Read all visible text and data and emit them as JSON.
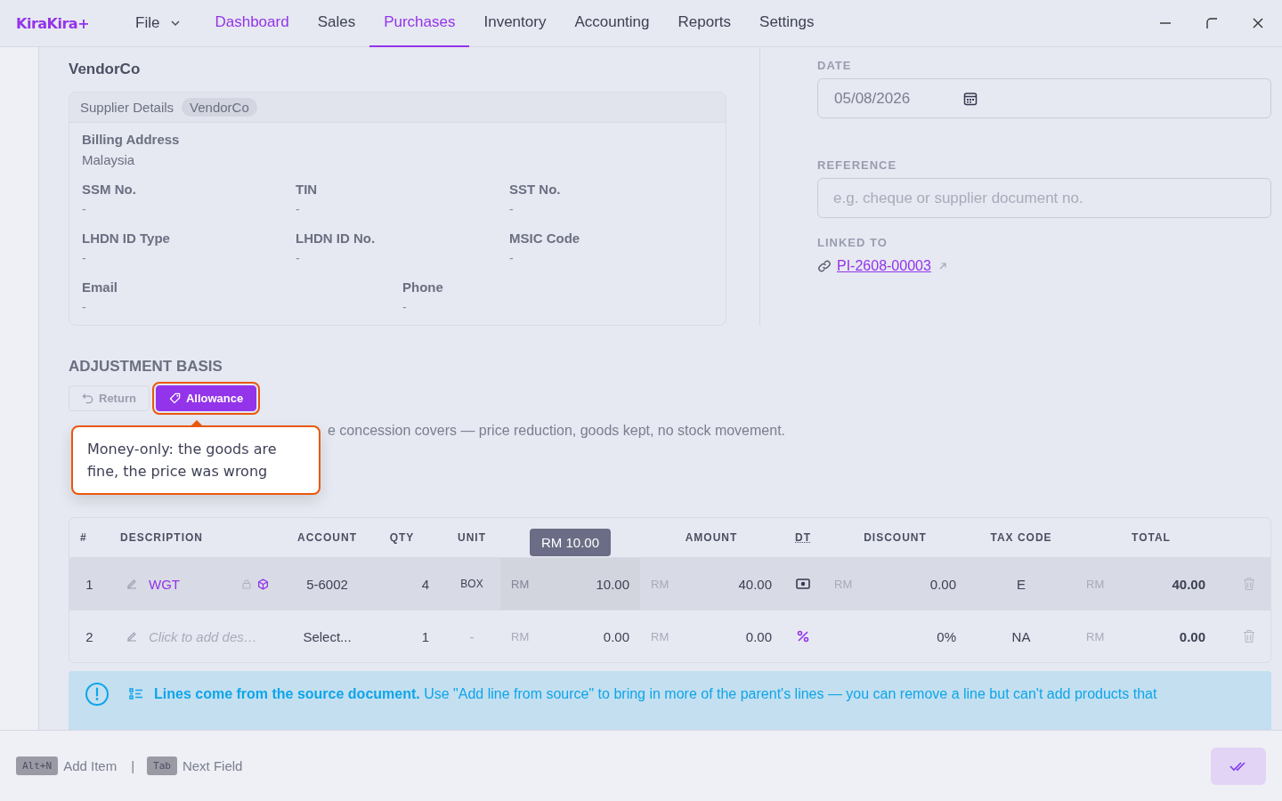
{
  "app": {
    "logo": "KiraKira+"
  },
  "menu": {
    "file": "File"
  },
  "tabs": [
    {
      "label": "Dashboard",
      "selected": false,
      "hovered": true
    },
    {
      "label": "Sales",
      "selected": false,
      "hovered": false
    },
    {
      "label": "Purchases",
      "selected": true,
      "hovered": false
    },
    {
      "label": "Inventory",
      "selected": false,
      "hovered": false
    },
    {
      "label": "Accounting",
      "selected": false,
      "hovered": false
    },
    {
      "label": "Reports",
      "selected": false,
      "hovered": false
    },
    {
      "label": "Settings",
      "selected": false,
      "hovered": false
    }
  ],
  "supplier_name": "VendorCo",
  "supplier_card": {
    "title": "Supplier Details",
    "badge": "VendorCo",
    "billing_label": "Billing Address",
    "billing_value": "Malaysia",
    "fields": [
      {
        "label": "SSM No.",
        "value": "-"
      },
      {
        "label": "TIN",
        "value": "-"
      },
      {
        "label": "SST No.",
        "value": "-"
      },
      {
        "label": "LHDN ID Type",
        "value": "-"
      },
      {
        "label": "LHDN ID No.",
        "value": "-"
      },
      {
        "label": "MSIC Code",
        "value": "-"
      }
    ],
    "contact_fields": [
      {
        "label": "Email",
        "value": "-"
      },
      {
        "label": "Phone",
        "value": "-"
      }
    ]
  },
  "date": {
    "label": "DATE",
    "value": "05/08/2026"
  },
  "reference": {
    "label": "REFERENCE",
    "placeholder": "e.g. cheque or supplier document no."
  },
  "linked": {
    "label": "LINKED TO",
    "link": "PI-2608-00003"
  },
  "adjustment": {
    "title": "ADJUSTMENT BASIS",
    "options": [
      {
        "label": "Return",
        "kind": "return",
        "selected": false
      },
      {
        "label": "Allowance",
        "kind": "allowance",
        "selected": true
      }
    ],
    "description_end": "e concession covers — price reduction, goods kept, no stock movement.",
    "tooltip": "Money-only: the goods are fine, the price was wrong"
  },
  "table": {
    "columns": [
      "#",
      "DESCRIPTION",
      "ACCOUNT",
      "QTY",
      "UNIT",
      "",
      "AMOUNT",
      "DT",
      "DISCOUNT",
      "TAX CODE",
      "TOTAL"
    ],
    "price_tooltip": "RM 10.00",
    "rows": [
      {
        "no": "1",
        "description": "WGT",
        "placeholder": false,
        "locked": true,
        "account": "5-6002",
        "qty": "4",
        "unit": "BOX",
        "price_currency": "RM",
        "price": "10.00",
        "price_focused": true,
        "amount_currency": "RM",
        "amount": "40.00",
        "discount_percent": false,
        "discount_currency": "RM",
        "discount": "0.00",
        "tax_code": "E",
        "total_currency": "RM",
        "total": "40.00",
        "selected": true
      },
      {
        "no": "2",
        "description": "Click to add des…",
        "placeholder": true,
        "locked": false,
        "account": "Select...",
        "qty": "1",
        "unit": "-",
        "price_currency": "RM",
        "price": "0.00",
        "price_focused": false,
        "amount_currency": "RM",
        "amount": "0.00",
        "discount_percent": true,
        "discount_currency": "",
        "discount": "0%",
        "tax_code": "NA",
        "total_currency": "RM",
        "total": "0.00",
        "selected": false
      }
    ]
  },
  "notice": {
    "title": "Lines come from the source document.",
    "text": "Use \"Add line from source\" to bring in more of the parent's lines — you can remove a line but can't add products that"
  },
  "footer": {
    "shortcuts": [
      {
        "key": "Alt+N",
        "label": "Add Item"
      },
      {
        "key": "Tab",
        "label": "Next Field"
      }
    ],
    "separator": "|"
  }
}
